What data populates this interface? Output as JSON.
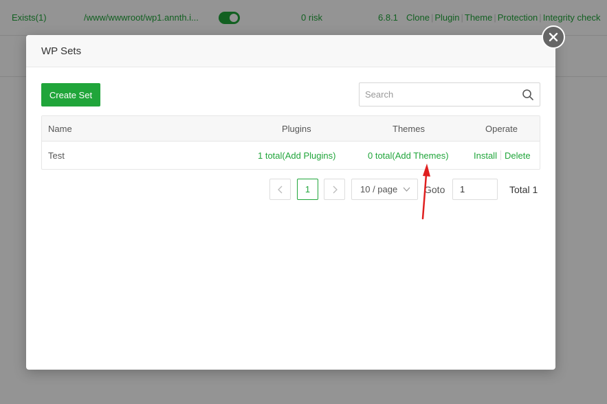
{
  "background_row": {
    "status": "Exists(1)",
    "path": "/www/wwwroot/wp1.annth.i...",
    "risk": "0 risk",
    "version": "6.8.1",
    "actions": [
      "Clone",
      "Plugin",
      "Theme",
      "Protection",
      "Integrity check"
    ]
  },
  "dialog": {
    "title": "WP Sets",
    "close_icon": "close-icon",
    "create_label": "Create Set",
    "search_placeholder": "Search",
    "search_value": "",
    "table": {
      "headers": {
        "name": "Name",
        "plugins": "Plugins",
        "themes": "Themes",
        "operate": "Operate"
      },
      "rows": [
        {
          "name": "Test",
          "plugins": "1 total(Add Plugins)",
          "themes": "0 total(Add Themes)",
          "install": "Install",
          "delete": "Delete"
        }
      ]
    },
    "pagination": {
      "current_page": "1",
      "page_size": "10 / page",
      "goto_label": "Goto",
      "goto_value": "1",
      "total": "Total 1"
    }
  },
  "colors": {
    "accent": "#20a53a",
    "annotation_arrow": "#e02020"
  }
}
